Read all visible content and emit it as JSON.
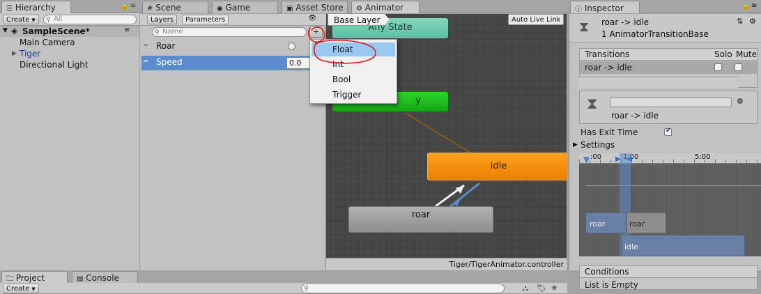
{
  "hierarchy": {
    "tab": "Hierarchy",
    "create": "Create",
    "search_placeholder": "All",
    "scene": "SampleScene*",
    "items": [
      "Main Camera",
      "Tiger",
      "Directional Light"
    ]
  },
  "center_tabs": [
    "Scene",
    "Game",
    "Asset Store",
    "Animator"
  ],
  "animator": {
    "subtabs": [
      "Layers",
      "Parameters"
    ],
    "search_placeholder": "Name",
    "params": [
      {
        "name": "Roar",
        "value": ""
      },
      {
        "name": "Speed",
        "value": "0.0"
      }
    ],
    "breadcrumb": "Base Layer",
    "auto_live": "Auto Live Link",
    "nodes": {
      "any_state": "Any State",
      "entry": "y",
      "idle": "idle",
      "roar": "roar"
    },
    "path": "Tiger/TigerAnimator.controller",
    "menu": [
      "Float",
      "Int",
      "Bool",
      "Trigger"
    ]
  },
  "inspector": {
    "tab": "Inspector",
    "title": "roar -> idle",
    "subtitle": "1 AnimatorTransitionBase",
    "transitions_header": "Transitions",
    "solo": "Solo",
    "mute": "Mute",
    "transition_item": "roar -> idle",
    "transition_name": "roar -> idle",
    "has_exit_time": "Has Exit Time",
    "settings": "Settings",
    "timeline_labels": [
      ":00",
      "1:00",
      "5:00"
    ],
    "clip_roar_a": "roar",
    "clip_roar_b": "roar",
    "clip_idle": "idle",
    "conditions": "Conditions",
    "conditions_empty": "List is Empty"
  },
  "bottom": {
    "project_tab": "Project",
    "console_tab": "Console",
    "create": "Create"
  },
  "colors": {
    "any_state": "#66c2a5",
    "entry": "#17b317",
    "idle": "#f08a00",
    "roar": "#a0a0a0",
    "selection": "#5b8ccf",
    "annotation": "#e8161e"
  }
}
